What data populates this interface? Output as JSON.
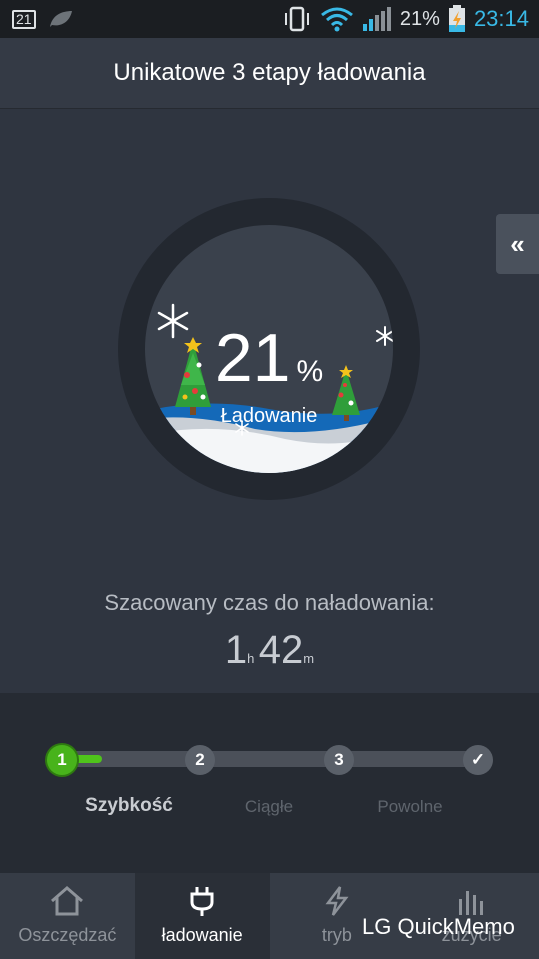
{
  "status_bar": {
    "calendar_day": "21",
    "battery_percent": "21%",
    "clock": "23:14"
  },
  "header": {
    "title": "Unikatowe 3 etapy ładowania"
  },
  "gauge": {
    "percent_value": "21",
    "percent_sign": "%",
    "label": "Ładowanie",
    "level": 0.21
  },
  "estimate": {
    "label": "Szacowany czas do naładowania:",
    "hours": "1",
    "hours_unit": "h",
    "minutes": "42",
    "minutes_unit": "m"
  },
  "stages": {
    "nodes": [
      "1",
      "2",
      "3",
      "✓"
    ],
    "labels": [
      "Szybkość",
      "Ciągłe",
      "Powolne"
    ],
    "active_index": 0
  },
  "nav": {
    "items": [
      {
        "label": "Oszczędzać",
        "icon": "home-icon"
      },
      {
        "label": "ładowanie",
        "icon": "plug-icon"
      },
      {
        "label": "tryb",
        "icon": "lightning-icon"
      },
      {
        "label": "zużycie",
        "icon": "bar-chart-icon"
      }
    ],
    "active_index": 1
  },
  "overlay": {
    "quickmemo": "LG QuickMemo"
  },
  "colors": {
    "accent_green": "#4fc41b",
    "clock_blue": "#39b9e6",
    "background": "#2f3540"
  }
}
